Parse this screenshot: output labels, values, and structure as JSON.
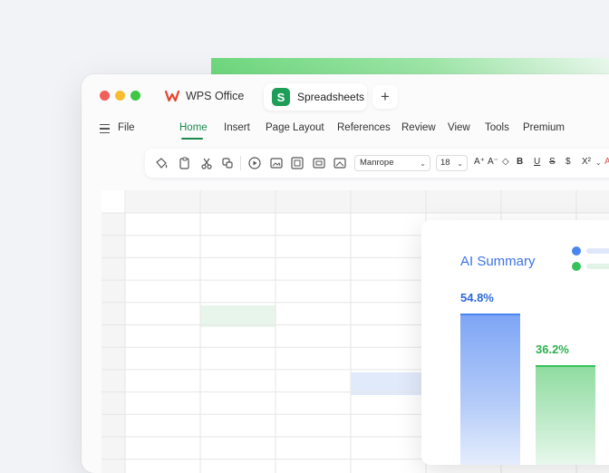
{
  "app": {
    "name": "WPS Office",
    "doc_tab": "Spreadsheets",
    "doc_tab_letter": "S",
    "new_tab": "+"
  },
  "menu": {
    "file": "File",
    "items": [
      "Home",
      "Insert",
      "Page Layout",
      "References",
      "Review",
      "View",
      "Tools",
      "Premium"
    ],
    "active": "Home"
  },
  "toolbar": {
    "font": "Manrope",
    "size": "18",
    "format_glyphs": [
      "A⁺",
      "A⁻",
      "◇",
      "B",
      "U",
      "S",
      "$",
      "X²"
    ],
    "icons": [
      "paint-bucket-icon",
      "paste-icon",
      "cut-icon",
      "copy-format-icon",
      "play-icon",
      "image-icon",
      "chart-icon",
      "picture-frame-icon",
      "photo-icon"
    ]
  },
  "ai_summary": {
    "title": "AI Summary",
    "colors": {
      "blue": "#4a86f0",
      "green": "#36c25a"
    },
    "chart_data": {
      "type": "bar",
      "values": [
        54.8,
        36.2
      ],
      "labels": [
        "54.8%",
        "36.2%"
      ],
      "colors": [
        "#4a86f0",
        "#36c25a"
      ]
    }
  },
  "colors": {
    "accent": "#1b8a4c",
    "stripe": "#6fd97f"
  }
}
